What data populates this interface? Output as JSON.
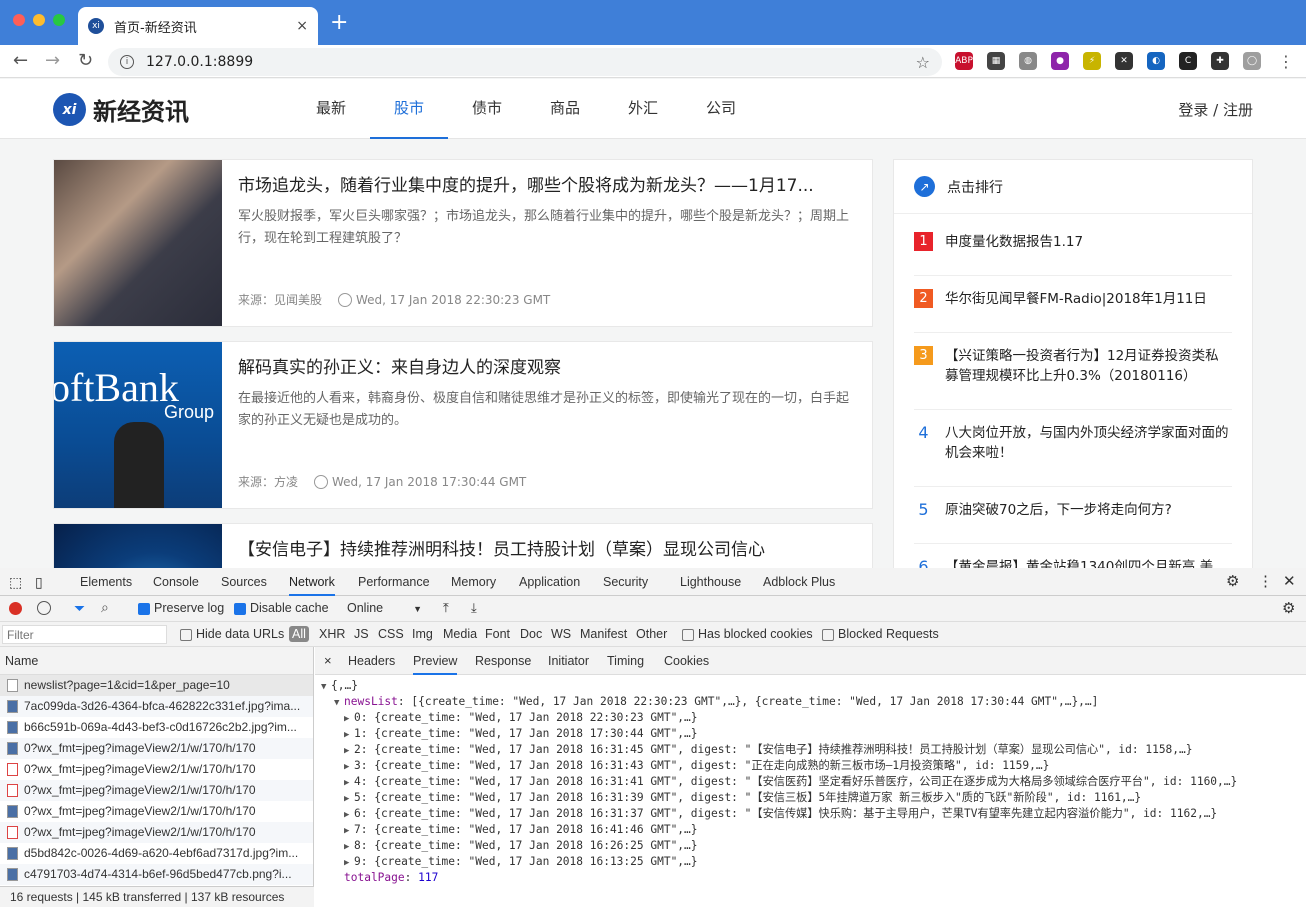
{
  "browser": {
    "tab_title": "首页-新经资讯",
    "favicon_text": "xi",
    "close_glyph": "×",
    "newtab_glyph": "+",
    "url": "127.0.0.1:8899",
    "info_glyph": "i",
    "star_glyph": "☆",
    "nav": {
      "back": "←",
      "forward": "→",
      "reload": "↻",
      "menu": "⋮"
    },
    "extensions": [
      {
        "label": "ABP",
        "color": "#c8102e",
        "icon": "adblock-icon"
      },
      {
        "label": "▦",
        "color": "#444444",
        "icon": "qr-icon"
      },
      {
        "label": "◍",
        "color": "#888888",
        "icon": "globe-icon"
      },
      {
        "label": "●",
        "color": "#8e24aa",
        "icon": "extension-purple-icon"
      },
      {
        "label": "⚡",
        "color": "#c8b400",
        "icon": "bolt-icon"
      },
      {
        "label": "✕",
        "color": "#333333",
        "icon": "x-extension-icon"
      },
      {
        "label": "◐",
        "color": "#1565c0",
        "icon": "translate-icon"
      },
      {
        "label": "C",
        "color": "#222222",
        "icon": "c-extension-icon"
      },
      {
        "label": "✚",
        "color": "#333333",
        "icon": "puzzle-icon"
      },
      {
        "label": "◯",
        "color": "#9e9e9e",
        "icon": "profile-icon"
      }
    ]
  },
  "site": {
    "logo_mark": "xi",
    "logo_name": "新经资讯",
    "nav": [
      "最新",
      "股市",
      "债市",
      "商品",
      "外汇",
      "公司"
    ],
    "active_nav": 1,
    "login": "登录 / 注册",
    "news": [
      {
        "title": "市场追龙头，随着行业集中度的提升，哪些个股将成为新龙头？——1月17...",
        "digest": "军火股财报季，军火巨头哪家强？；市场追龙头，那么随着行业集中的提升，哪些个股是新龙头？；周期上行，现在轮到工程建筑股了？",
        "source": "来源：见闻美股",
        "time": "Wed, 17 Jan 2018 22:30:23 GMT"
      },
      {
        "title": "解码真实的孙正义：来自身边人的深度观察",
        "digest": "在最接近他的人看来，韩裔身份、极度自信和赌徒思维才是孙正义的标签，即使输光了现在的一切，白手起家的孙正义无疑也是成功的。",
        "source": "来源：方凌",
        "time": "Wed, 17 Jan 2018 17:30:44 GMT",
        "thumb_text_1": "oftBank",
        "thumb_text_2": "Group"
      },
      {
        "title": "【安信电子】持续推荐洲明科技！员工持股计划（草案）显现公司信心",
        "digest": "",
        "source": "",
        "time": ""
      }
    ],
    "rank_title": "点击排行",
    "rank_icon": "↗",
    "rank": [
      {
        "num": "1",
        "text": "申度量化数据报告1.17",
        "color": "#e8232b"
      },
      {
        "num": "2",
        "text": "华尔街见闻早餐FM-Radio|2018年1月11日",
        "color": "#f05a22"
      },
      {
        "num": "3",
        "text": "【兴证策略一投资者行为】12月证券投资类私募管理规模环比上升0.3%（20180116）",
        "color": "#f59a1c"
      },
      {
        "num": "4",
        "text": "八大岗位开放，与国内外顶尖经济学家面对面的机会来啦！",
        "color": ""
      },
      {
        "num": "5",
        "text": "原油突破70之后，下一步将走向何方?",
        "color": ""
      },
      {
        "num": "6",
        "text": "【黄金晨报】黄金站稳1340创四个月新高 美",
        "color": ""
      }
    ]
  },
  "devtools": {
    "tabs": [
      "Elements",
      "Console",
      "Sources",
      "Network",
      "Performance",
      "Memory",
      "Application",
      "Security",
      "Lighthouse",
      "Adblock Plus"
    ],
    "active_tab": "Network",
    "preserve_log": "Preserve log",
    "disable_cache": "Disable cache",
    "throttle": "Online",
    "filter_placeholder": "Filter",
    "hide_data_urls": "Hide data URLs",
    "types": [
      "All",
      "XHR",
      "JS",
      "CSS",
      "Img",
      "Media",
      "Font",
      "Doc",
      "WS",
      "Manifest",
      "Other"
    ],
    "has_blocked": "Has blocked cookies",
    "blocked_requests": "Blocked Requests",
    "name_header": "Name",
    "requests": [
      {
        "name": "newslist?page=1&cid=1&per_page=10",
        "kind": "doc"
      },
      {
        "name": "7ac099da-3d26-4364-bfca-462822c331ef.jpg?ima...",
        "kind": "img"
      },
      {
        "name": "b66c591b-069a-4d43-bef3-c0d16726c2b2.jpg?im...",
        "kind": "img"
      },
      {
        "name": "0?wx_fmt=jpeg?imageView2/1/w/170/h/170",
        "kind": "img"
      },
      {
        "name": "0?wx_fmt=jpeg?imageView2/1/w/170/h/170",
        "kind": "red"
      },
      {
        "name": "0?wx_fmt=jpeg?imageView2/1/w/170/h/170",
        "kind": "red"
      },
      {
        "name": "0?wx_fmt=jpeg?imageView2/1/w/170/h/170",
        "kind": "img"
      },
      {
        "name": "0?wx_fmt=jpeg?imageView2/1/w/170/h/170",
        "kind": "red"
      },
      {
        "name": "d5bd842c-0026-4d69-a620-4ebf6ad7317d.jpg?im...",
        "kind": "img"
      },
      {
        "name": "c4791703-4d74-4314-b6ef-96d5bed477cb.png?i...",
        "kind": "img"
      }
    ],
    "summary": "16 requests  |  145 kB transferred  |  137 kB resources",
    "detail_close": "×",
    "detail_tabs": [
      "Headers",
      "Preview",
      "Response",
      "Initiator",
      "Timing",
      "Cookies"
    ],
    "active_detail": "Preview",
    "preview": {
      "root": "{,…}",
      "newslist_key": "newsList",
      "newslist_summary": "[{create_time: \"Wed, 17 Jan 2018 22:30:23 GMT\",…}, {create_time: \"Wed, 17 Jan 2018 17:30:44 GMT\",…},…]",
      "items": [
        "0: {create_time: \"Wed, 17 Jan 2018 22:30:23 GMT\",…}",
        "1: {create_time: \"Wed, 17 Jan 2018 17:30:44 GMT\",…}",
        "2: {create_time: \"Wed, 17 Jan 2018 16:31:45 GMT\", digest: \"【安信电子】持续推荐洲明科技！员工持股计划（草案）显现公司信心\", id: 1158,…}",
        "3: {create_time: \"Wed, 17 Jan 2018 16:31:43 GMT\", digest: \"正在走向成熟的新三板市场—1月投资策略\", id: 1159,…}",
        "4: {create_time: \"Wed, 17 Jan 2018 16:31:41 GMT\", digest: \"【安信医药】坚定看好乐普医疗，公司正在逐步成为大格局多领域综合医疗平台\", id: 1160,…}",
        "5: {create_time: \"Wed, 17 Jan 2018 16:31:39 GMT\", digest: \"【安信三板】5年挂牌道万家 新三板步入\"质的飞跃\"新阶段\", id: 1161,…}",
        "6: {create_time: \"Wed, 17 Jan 2018 16:31:37 GMT\", digest: \"【安信传媒】快乐购：基于主导用户，芒果TV有望率先建立起内容溢价能力\", id: 1162,…}",
        "7: {create_time: \"Wed, 17 Jan 2018 16:41:46 GMT\",…}",
        "8: {create_time: \"Wed, 17 Jan 2018 16:26:25 GMT\",…}",
        "9: {create_time: \"Wed, 17 Jan 2018 16:13:25 GMT\",…}"
      ],
      "total_key": "totalPage",
      "total_value": "117"
    }
  }
}
